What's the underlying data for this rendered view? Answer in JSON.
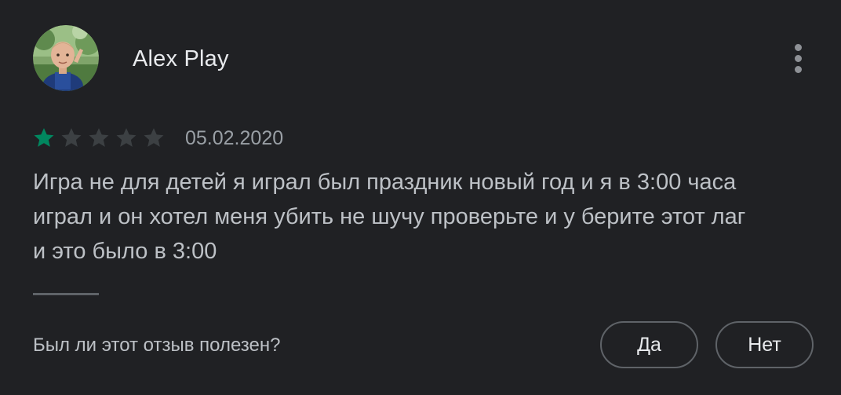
{
  "review": {
    "author": "Alex Play",
    "rating": 1,
    "max_rating": 5,
    "date": "05.02.2020",
    "text": "Игра не для детей я играл был праздник новый год и я в 3:00 часа\nиграл и он хотел меня убить не шучу проверьте и у берите этот лаг\nи это было в 3:00"
  },
  "feedback": {
    "question": "Был ли этот отзыв полезен?",
    "yes_label": "Да",
    "no_label": "Нет"
  },
  "icons": {
    "more": "more-vertical-icon",
    "star": "star-icon"
  },
  "colors": {
    "background": "#202124",
    "star_filled": "#01875f",
    "star_empty": "#3c4043",
    "text_primary": "#e8eaed",
    "text_secondary": "#bdc1c6",
    "border": "#5f6368"
  }
}
